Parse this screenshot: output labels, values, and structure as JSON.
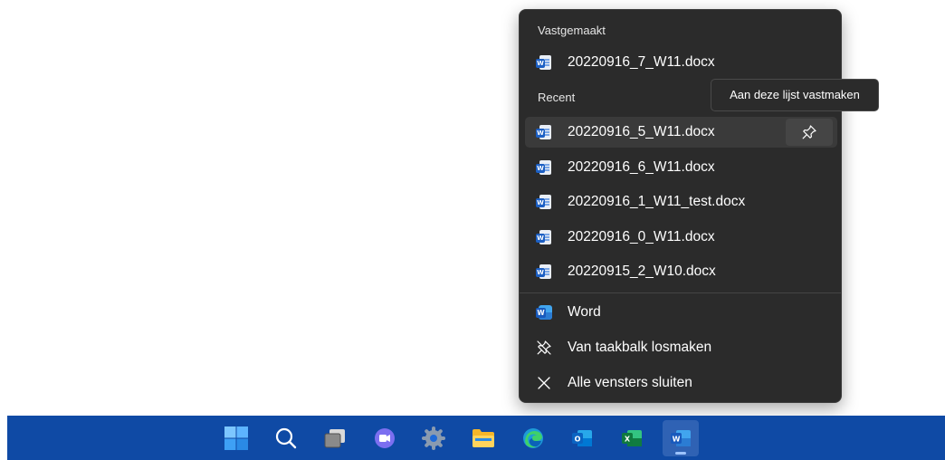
{
  "jumplist": {
    "pinned_header": "Vastgemaakt",
    "pinned": [
      {
        "label": "20220916_7_W11.docx",
        "icon": "word-document-icon"
      }
    ],
    "recent_header": "Recent",
    "recent": [
      {
        "label": "20220916_5_W11.docx",
        "icon": "word-document-icon"
      },
      {
        "label": "20220916_6_W11.docx",
        "icon": "word-document-icon"
      },
      {
        "label": "20220916_1_W11_test.docx",
        "icon": "word-document-icon"
      },
      {
        "label": "20220916_0_W11.docx",
        "icon": "word-document-icon"
      },
      {
        "label": "20220915_2_W10.docx",
        "icon": "word-document-icon"
      }
    ],
    "tasks": [
      {
        "label": "Word",
        "icon": "word-app-icon"
      },
      {
        "label": "Van taakbalk losmaken",
        "icon": "unpin-icon"
      },
      {
        "label": "Alle vensters sluiten",
        "icon": "close-icon"
      }
    ]
  },
  "tooltip": {
    "text": "Aan deze lijst vastmaken"
  },
  "taskbar": {
    "background": "#0f4aa5",
    "icons": [
      "start-icon",
      "search-icon",
      "task-view-icon",
      "chat-icon",
      "settings-icon",
      "file-explorer-icon",
      "edge-icon",
      "outlook-icon",
      "excel-icon",
      "word-icon"
    ],
    "active": "word-icon"
  }
}
